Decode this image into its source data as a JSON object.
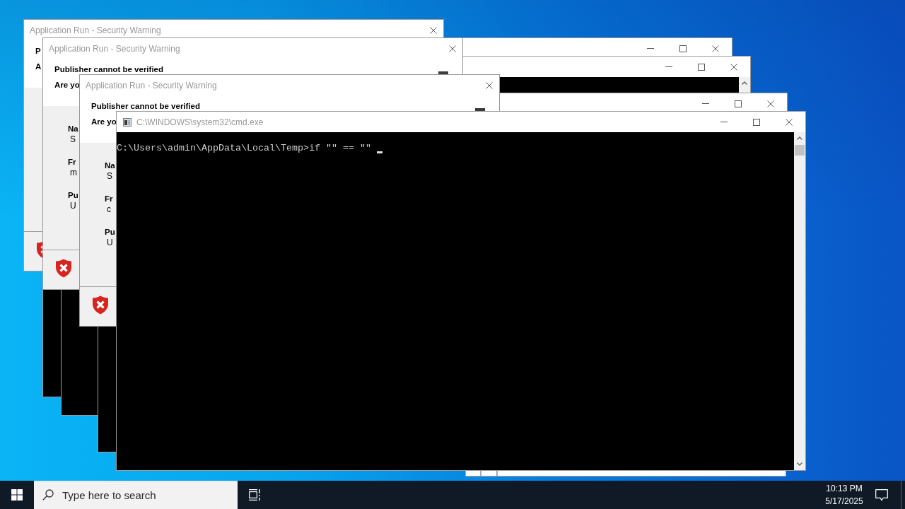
{
  "windows": [
    {
      "kind": "dialog",
      "title": "Application Run - Security Warning",
      "heading": "P",
      "prompt": "A"
    },
    {
      "kind": "console"
    },
    {
      "kind": "console"
    },
    {
      "kind": "console"
    },
    {
      "kind": "dialog",
      "title": "Application Run - Security Warning",
      "heading": "Publisher cannot be verified",
      "prompt": "Are yo",
      "fields": [
        {
          "label": "Na",
          "value": "S"
        },
        {
          "label": "Fr",
          "value": "m"
        },
        {
          "label": "Pu",
          "value": "U"
        }
      ]
    },
    {
      "kind": "dialog",
      "title": "Application Run - Security Warning",
      "heading": "Publisher cannot be verified",
      "prompt": "Are yo",
      "fields": [
        {
          "label": "Na",
          "value": "S"
        },
        {
          "label": "Fr",
          "value": "c"
        },
        {
          "label": "Pu",
          "value": "U"
        }
      ]
    },
    {
      "kind": "console",
      "title": "C:\\WINDOWS\\system32\\cmd.exe",
      "lines": [
        "C:\\Users\\admin\\AppData\\Local\\Temp>if \"\" == \"\""
      ]
    }
  ],
  "taskbar": {
    "search": {
      "placeholder": "Type here to search"
    },
    "clock": {
      "time": "10:13 PM",
      "date": "5/17/2025"
    }
  }
}
